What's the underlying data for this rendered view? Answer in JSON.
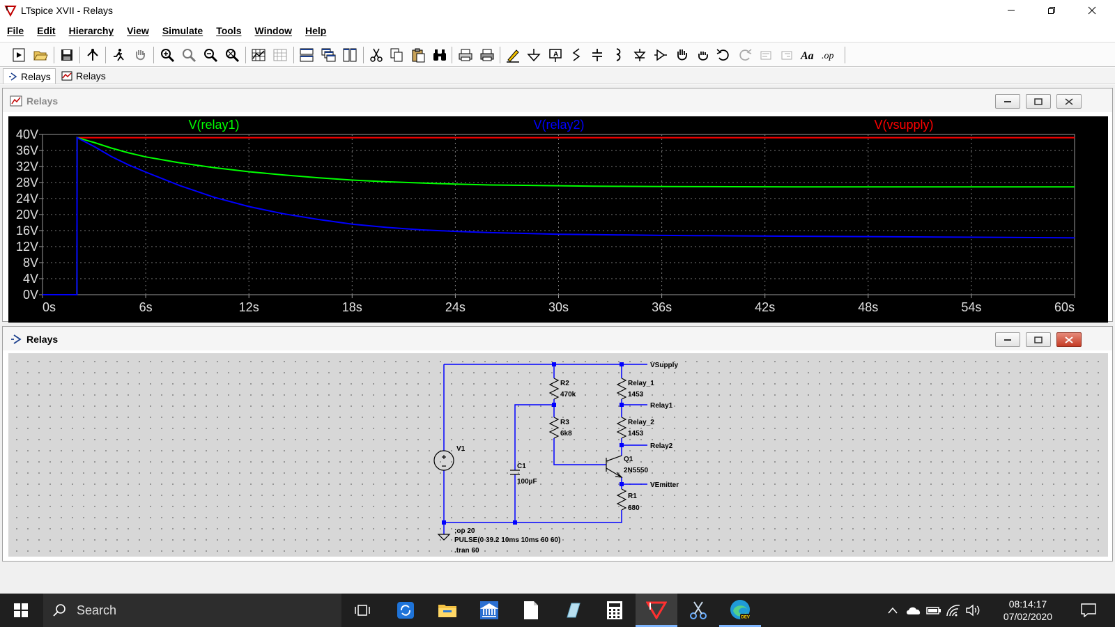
{
  "window": {
    "title": "LTspice XVII - Relays"
  },
  "menu": [
    "File",
    "Edit",
    "Hierarchy",
    "View",
    "Simulate",
    "Tools",
    "Window",
    "Help"
  ],
  "toolbar_icons": [
    "new-schematic-icon",
    "open-icon",
    "save-icon",
    "control-panel-icon",
    "run-icon",
    "halt-icon",
    "zoom-in-icon",
    "zoom-pan-icon",
    "zoom-out-icon",
    "zoom-fit-icon",
    "autorange-icon",
    "clear-plot-icon",
    "tile-horizontal-icon",
    "cascade-icon",
    "tile-vertical-icon",
    "cut-icon",
    "copy-icon",
    "paste-icon",
    "find-icon",
    "print-setup-icon",
    "print-icon",
    "draw-wire-icon",
    "ground-icon",
    "label-net-icon",
    "resistor-icon",
    "capacitor-icon",
    "inductor-icon",
    "diode-icon",
    "component-icon",
    "move-icon",
    "drag-icon",
    "undo-icon",
    "redo-icon",
    "rotate-icon",
    "mirror-icon",
    "text-icon",
    "spice-directive-icon"
  ],
  "tabs": [
    {
      "label": "Relays",
      "icon": "schematic-icon"
    },
    {
      "label": "Relays",
      "icon": "waveform-icon"
    }
  ],
  "plot_window": {
    "title": "Relays"
  },
  "schematic_window": {
    "title": "Relays"
  },
  "chart_data": {
    "type": "line",
    "series": [
      {
        "name": "V(relay1)",
        "color": "#00ff00",
        "x": [
          0,
          2,
          2.01,
          3,
          4,
          5,
          6,
          8,
          10,
          12,
          14,
          16,
          18,
          20,
          22,
          24,
          26,
          28,
          30,
          32,
          34,
          36,
          38,
          40,
          44,
          48,
          52,
          56,
          60
        ],
        "y": [
          0,
          0,
          39.2,
          38.0,
          36.6,
          35.4,
          34.4,
          32.9,
          31.7,
          30.7,
          29.9,
          29.2,
          28.6,
          28.2,
          27.9,
          27.6,
          27.4,
          27.3,
          27.2,
          27.1,
          27.05,
          27.0,
          26.98,
          26.95,
          26.92,
          26.9,
          26.9,
          26.9,
          26.9
        ]
      },
      {
        "name": "V(relay2)",
        "color": "#0000ff",
        "x": [
          0,
          2,
          2.01,
          3,
          4,
          5,
          6,
          8,
          10,
          12,
          14,
          16,
          18,
          20,
          22,
          24,
          26,
          28,
          30,
          32,
          34,
          36,
          38,
          40,
          44,
          48,
          52,
          56,
          60
        ],
        "y": [
          0,
          0,
          39.2,
          37.0,
          34.5,
          32.4,
          30.6,
          27.2,
          24.3,
          22.0,
          20.2,
          18.8,
          17.6,
          16.8,
          16.2,
          15.8,
          15.5,
          15.3,
          15.1,
          15.0,
          14.9,
          14.8,
          14.75,
          14.7,
          14.6,
          14.5,
          14.4,
          14.3,
          14.2
        ]
      },
      {
        "name": "V(vsupply)",
        "color": "#ff0000",
        "x": [
          0,
          2,
          2.01,
          60
        ],
        "y": [
          0,
          0,
          39.2,
          39.2
        ]
      }
    ],
    "xlim": [
      0,
      60
    ],
    "ylim": [
      0,
      40
    ],
    "xticks": [
      "0s",
      "6s",
      "12s",
      "18s",
      "24s",
      "30s",
      "36s",
      "42s",
      "48s",
      "54s",
      "60s"
    ],
    "yticks": [
      "0V",
      "4V",
      "8V",
      "12V",
      "16V",
      "20V",
      "24V",
      "28V",
      "32V",
      "36V",
      "40V"
    ],
    "grid": true
  },
  "schematic": {
    "nets": [
      "VSupply",
      "Relay1",
      "Relay2",
      "VEmitter"
    ],
    "components": [
      {
        "ref": "R2",
        "value": "470k"
      },
      {
        "ref": "R3",
        "value": "6k8"
      },
      {
        "ref": "Relay_1",
        "value": "1453"
      },
      {
        "ref": "Relay_2",
        "value": "1453"
      },
      {
        "ref": "Q1",
        "value": "2N5550"
      },
      {
        "ref": "R1",
        "value": "680"
      },
      {
        "ref": "C1",
        "value": "100µF"
      },
      {
        "ref": "V1",
        "value": "PULSE(0 39.2 10ms 10ms 60 60)"
      }
    ],
    "directives": [
      ";op 20",
      ".tran 60"
    ]
  },
  "taskbar": {
    "search_placeholder": "Search",
    "time": "08:14:17",
    "date": "07/02/2020"
  }
}
